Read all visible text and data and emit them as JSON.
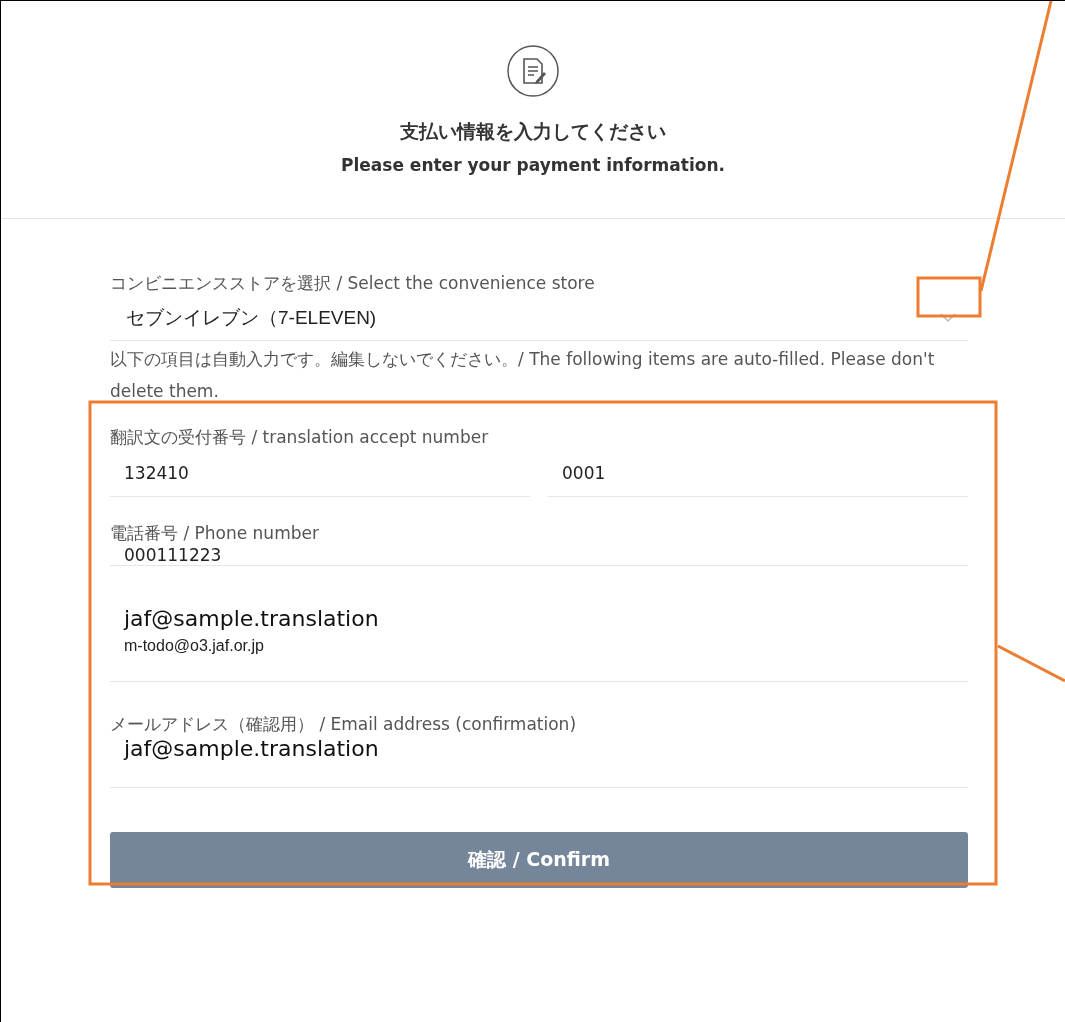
{
  "header": {
    "title": "支払い情報を入力してください",
    "subtitle": "Please enter your payment information."
  },
  "store": {
    "label": "コンビニエンスストアを選択 / Select the convenience store",
    "value": "セブンイレブン（7-ELEVEN)"
  },
  "notice": "以下の項目は自動入力です。編集しないでください。/ The following items are auto-filled. Please don't delete them.",
  "accept_number": {
    "label": "翻訳文の受付番号 / translation accept number",
    "values": [
      "132410",
      "0001"
    ]
  },
  "phone": {
    "label": "電話番号 / Phone number",
    "value": "000111223"
  },
  "email": {
    "overlay_text": "jaf@sample.translation",
    "value": "m-todo@o3.jaf.or.jp"
  },
  "email_confirm": {
    "label": "メールアドレス（確認用） / Email address (confirmation)",
    "overlay_text": "jaf@sample.translation"
  },
  "confirm_button": "確認 / Confirm"
}
